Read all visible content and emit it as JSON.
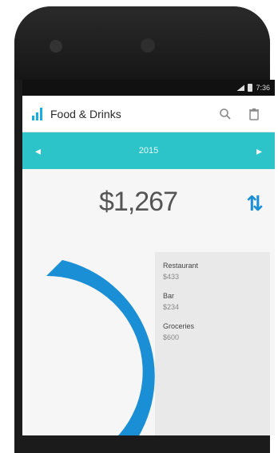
{
  "status_bar": {
    "time": "7:36"
  },
  "app_bar": {
    "title": "Food & Drinks",
    "search_icon": "search-icon",
    "delete_icon": "trash-icon"
  },
  "period_bar": {
    "label": "2015",
    "prev_icon": "chevron-left-icon",
    "next_icon": "chevron-right-icon"
  },
  "summary": {
    "total": "$1,267"
  },
  "legend": {
    "items": [
      {
        "name": "Restaurant",
        "value": "$433"
      },
      {
        "name": "Bar",
        "value": "$234"
      },
      {
        "name": "Groceries",
        "value": "$600"
      }
    ]
  },
  "colors": {
    "accent": "#2cc4c8",
    "chart": "#1a8fd6"
  }
}
